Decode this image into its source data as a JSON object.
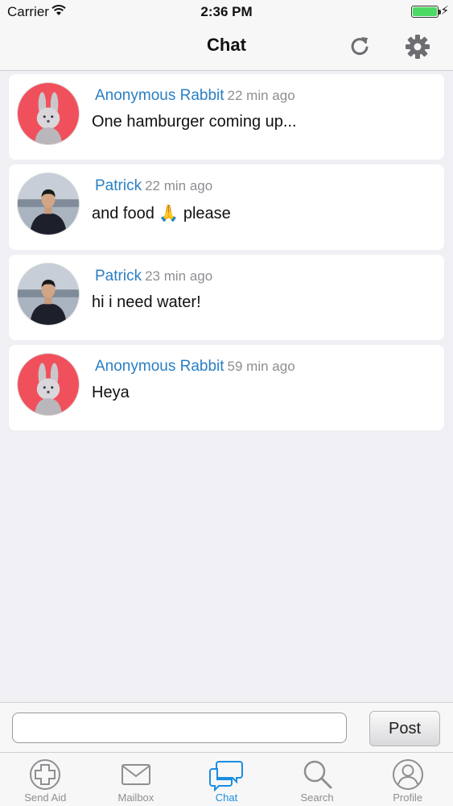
{
  "status_bar": {
    "carrier": "Carrier",
    "time": "2:36 PM"
  },
  "nav": {
    "title": "Chat"
  },
  "messages": [
    {
      "name": "Anonymous Rabbit",
      "time": "22 min ago",
      "text": "One hamburger coming up...",
      "avatar": "rabbit-avatar"
    },
    {
      "name": "Patrick",
      "time": "22 min ago",
      "text": "and food 🙏 please",
      "avatar": "person-photo-avatar"
    },
    {
      "name": "Patrick",
      "time": "23 min ago",
      "text": "hi i need water!",
      "avatar": "person-photo-avatar"
    },
    {
      "name": "Anonymous Rabbit",
      "time": "59 min ago",
      "text": "Heya",
      "avatar": "rabbit-avatar"
    }
  ],
  "composer": {
    "input_value": "",
    "post_label": "Post"
  },
  "tabs": [
    {
      "label": "Send Aid",
      "icon": "plus-circle-icon",
      "active": false
    },
    {
      "label": "Mailbox",
      "icon": "envelope-icon",
      "active": false
    },
    {
      "label": "Chat",
      "icon": "chat-bubbles-icon",
      "active": true
    },
    {
      "label": "Search",
      "icon": "magnifier-icon",
      "active": false
    },
    {
      "label": "Profile",
      "icon": "person-icon",
      "active": false
    }
  ],
  "colors": {
    "accent": "#1a8de0",
    "name": "#2a7fc4",
    "rabbit_bg": "#f0505c",
    "battery": "#4cd964"
  }
}
